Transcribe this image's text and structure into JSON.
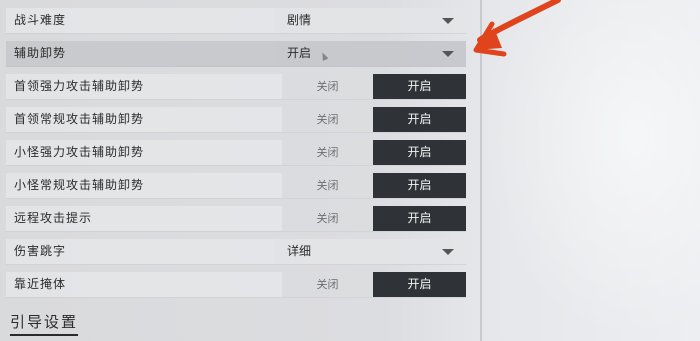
{
  "settings": {
    "rows": [
      {
        "label": "战斗难度",
        "type": "dropdown",
        "value": "剧情"
      },
      {
        "label": "辅助卸势",
        "type": "dropdown",
        "value": "开启",
        "highlighted": true
      },
      {
        "label": "首领强力攻击辅助卸势",
        "type": "toggle",
        "off_label": "关闭",
        "on_label": "开启",
        "selected": "on"
      },
      {
        "label": "首领常规攻击辅助卸势",
        "type": "toggle",
        "off_label": "关闭",
        "on_label": "开启",
        "selected": "on"
      },
      {
        "label": "小怪强力攻击辅助卸势",
        "type": "toggle",
        "off_label": "关闭",
        "on_label": "开启",
        "selected": "on"
      },
      {
        "label": "小怪常规攻击辅助卸势",
        "type": "toggle",
        "off_label": "关闭",
        "on_label": "开启",
        "selected": "on"
      },
      {
        "label": "远程攻击提示",
        "type": "toggle",
        "off_label": "关闭",
        "on_label": "开启",
        "selected": "on"
      },
      {
        "label": "伤害跳字",
        "type": "dropdown",
        "value": "详细"
      },
      {
        "label": "靠近掩体",
        "type": "toggle",
        "off_label": "关闭",
        "on_label": "开启",
        "selected": "on"
      }
    ],
    "section_title": "引导设置"
  },
  "icons": {
    "dropdown_caret": "chevron-down-icon",
    "annotation": "red-arrow-icon",
    "cursor": "mouse-cursor-icon"
  },
  "colors": {
    "selected_toggle": "#2f3236",
    "annotation_arrow": "#e0441c"
  }
}
